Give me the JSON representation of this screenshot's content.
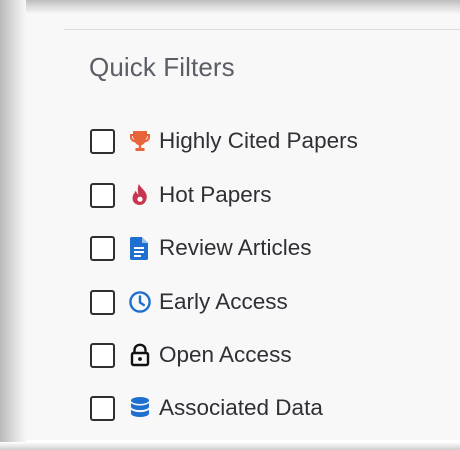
{
  "quick_filters": {
    "title": "Quick Filters",
    "items": [
      {
        "label": "Highly Cited Papers",
        "icon": "trophy-icon",
        "color": "#e8643a",
        "checked": false
      },
      {
        "label": "Hot Papers",
        "icon": "flame-icon",
        "color": "#c8364f",
        "checked": false
      },
      {
        "label": "Review Articles",
        "icon": "document-icon",
        "color": "#1e6fd0",
        "checked": false
      },
      {
        "label": "Early Access",
        "icon": "clock-icon",
        "color": "#1e6fd0",
        "checked": false
      },
      {
        "label": "Open Access",
        "icon": "unlocked-padlock-icon",
        "color": "#111111",
        "checked": false
      },
      {
        "label": "Associated Data",
        "icon": "database-icon",
        "color": "#1e6fd0",
        "checked": false
      }
    ]
  }
}
